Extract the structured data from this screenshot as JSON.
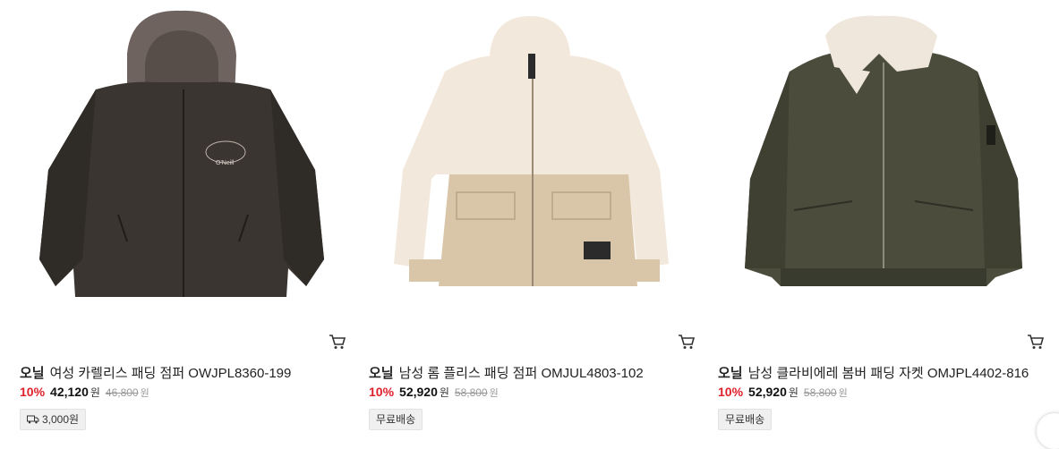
{
  "products": [
    {
      "brand": "오닐",
      "name": "여성 카렐리스 패딩 점퍼 OWJPL8360-199",
      "discount": "10%",
      "price": "42,120",
      "original_price": "46,800",
      "currency": "원",
      "shipping": "3,000원",
      "shipping_icon": "truck-icon",
      "image_colors": {
        "body": "#3a3530",
        "hood": "#6e635f"
      }
    },
    {
      "brand": "오닐",
      "name": "남성 롬 플리스 패딩 점퍼 OMJUL4803-102",
      "discount": "10%",
      "price": "52,920",
      "original_price": "58,800",
      "currency": "원",
      "shipping": "무료배송",
      "image_colors": {
        "body": "#f3e8dc",
        "lower": "#d9c5a7"
      }
    },
    {
      "brand": "오닐",
      "name": "남성 클라비에레 봄버 패딩 자켓 OMJPL4402-816",
      "discount": "10%",
      "price": "52,920",
      "original_price": "58,800",
      "currency": "원",
      "shipping": "무료배송",
      "image_colors": {
        "body": "#4b4c3b",
        "collar": "#f0e7dc"
      }
    }
  ],
  "colors": {
    "discount": "#e0202a"
  },
  "icons": {
    "cart": "cart-icon",
    "next": "next-circle-icon"
  }
}
